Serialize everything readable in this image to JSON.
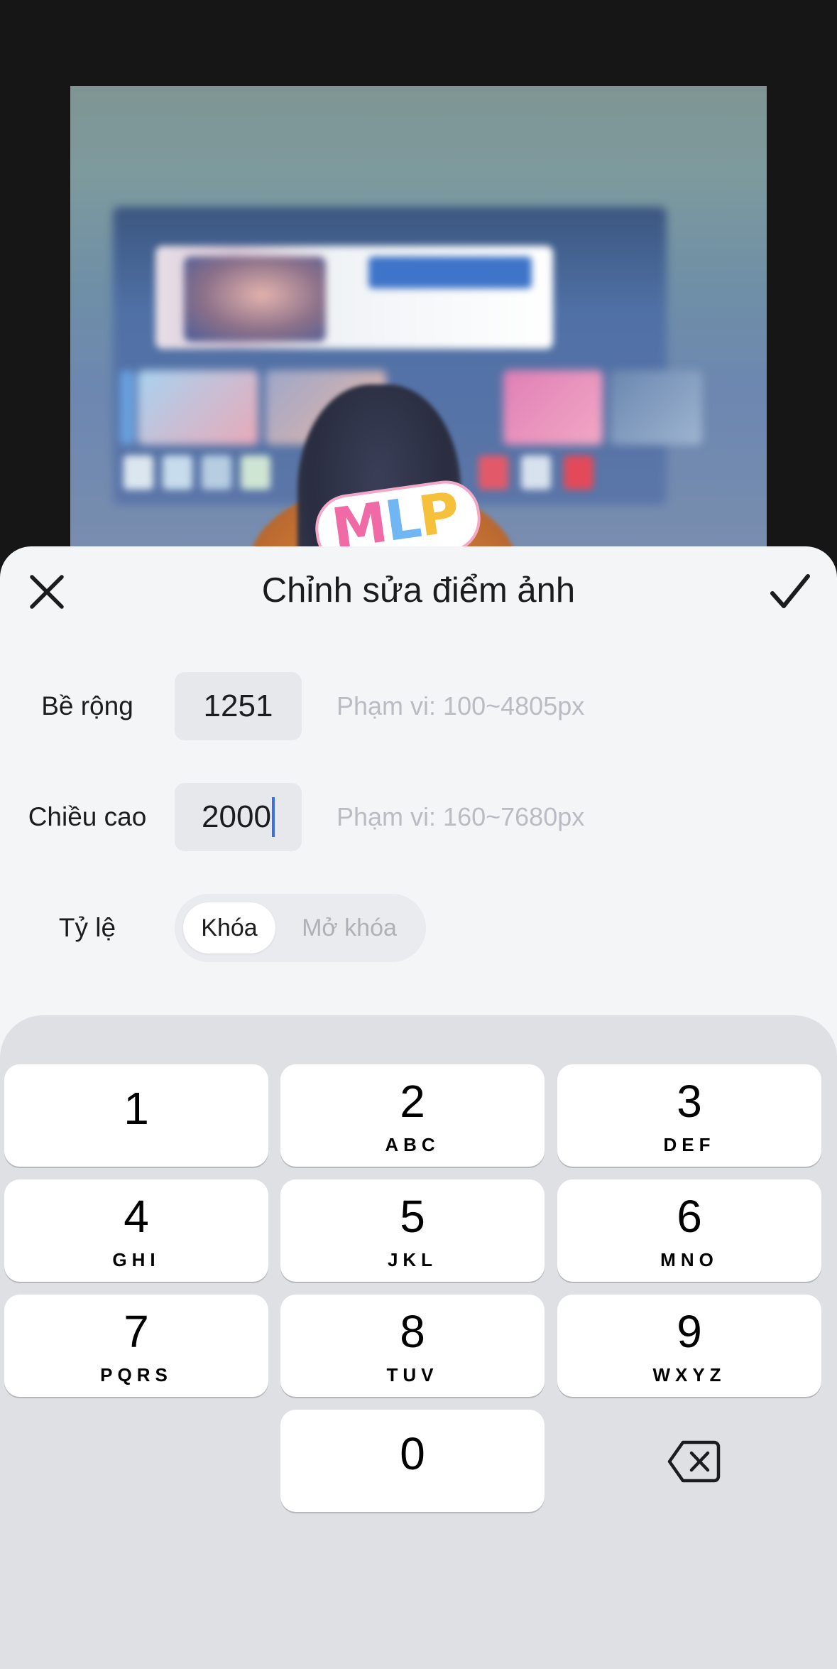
{
  "sheet": {
    "title": "Chỉnh sửa điểm ảnh",
    "close_icon": "close-icon",
    "confirm_icon": "checkmark-icon"
  },
  "width": {
    "label": "Bề rộng",
    "value": "1251",
    "range": "Phạm vi: 100~4805px"
  },
  "height": {
    "label": "Chiều cao",
    "value": "2000",
    "range": "Phạm vi: 160~7680px"
  },
  "ratio": {
    "label": "Tỷ lệ",
    "options": [
      "Khóa",
      "Mở khóa"
    ],
    "selected": "Khóa"
  },
  "photo": {
    "sticker_text": "MLP"
  },
  "keypad": {
    "keys": [
      {
        "digit": "1",
        "letters": ""
      },
      {
        "digit": "2",
        "letters": "ABC"
      },
      {
        "digit": "3",
        "letters": "DEF"
      },
      {
        "digit": "4",
        "letters": "GHI"
      },
      {
        "digit": "5",
        "letters": "JKL"
      },
      {
        "digit": "6",
        "letters": "MNO"
      },
      {
        "digit": "7",
        "letters": "PQRS"
      },
      {
        "digit": "8",
        "letters": "TUV"
      },
      {
        "digit": "9",
        "letters": "WXYZ"
      },
      {
        "digit": "0",
        "letters": ""
      }
    ],
    "backspace_icon": "backspace-icon"
  },
  "colors": {
    "caret": "#3d6fe3",
    "sheet_bg": "#f4f5f7",
    "keypad_bg": "#dfe0e4"
  }
}
